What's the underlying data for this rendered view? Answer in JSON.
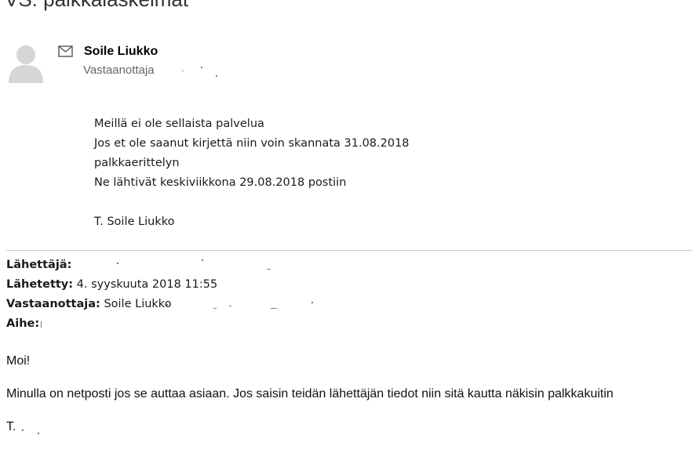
{
  "subject": {
    "text": "VS: palkkalaskelmat"
  },
  "sender": {
    "name": "Soile Liukko",
    "recipient_label": "Vastaanottaja"
  },
  "reply": {
    "lines": [
      "Meillä ei ole sellaista palvelua",
      "Jos et ole saanut kirjettä niin voin skannata 31.08.2018",
      "palkkaerittelyn",
      "Ne lähtivät keskiviikkona 29.08.2018 postiin"
    ],
    "signature": "T. Soile Liukko"
  },
  "original": {
    "from_label": "Lähettäjä:",
    "from_value": "",
    "sent_label": "Lähetetty:",
    "sent_value": "4. syyskuuta 2018 11:55",
    "to_label": "Vastaanottaja:",
    "to_value": "Soile Liukko",
    "subject_label": "Aihe:",
    "subject_value": "",
    "greeting": "Moi!",
    "body": "Minulla on netposti jos se auttaa asiaan. Jos saisin teidän lähettäjän tiedot niin sitä kautta näkisin palkkakuitin",
    "signoff": "T."
  },
  "icons": {
    "avatar": "person-silhouette-icon",
    "mail": "envelope-icon"
  },
  "colors": {
    "avatar_gray": "#d6d6d6",
    "divider": "#c9c9c9",
    "redaction_blue": "#3a8fd9"
  }
}
